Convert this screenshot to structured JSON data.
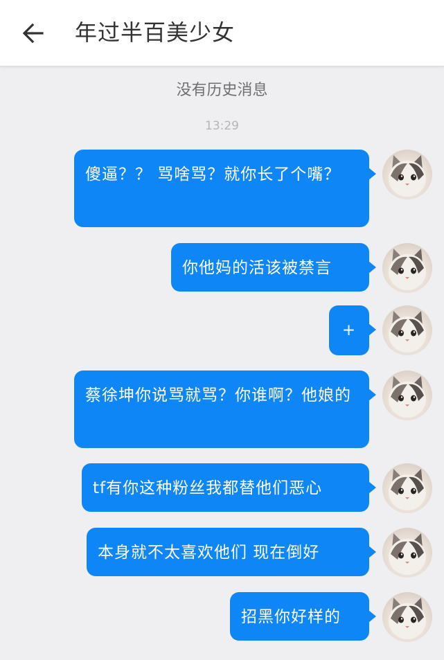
{
  "header": {
    "back_icon": "arrow-left-icon",
    "title": "年过半百美少女"
  },
  "chat": {
    "history_notice": "没有历史消息",
    "timestamp": "13:29",
    "avatar_icon": "cat-avatar-icon",
    "bubble_color": "#0f86f6",
    "messages": [
      {
        "text": "傻逼？？ 骂啥骂？就你长了个嘴？"
      },
      {
        "text": "你他妈的活该被禁言"
      },
      {
        "text": "+"
      },
      {
        "text": "蔡徐坤你说骂就骂？你谁啊？他娘的"
      },
      {
        "text": "tf有你这种粉丝我都替他们恶心"
      },
      {
        "text": "本身就不太喜欢他们 现在倒好"
      },
      {
        "text": "招黑你好样的"
      }
    ]
  }
}
